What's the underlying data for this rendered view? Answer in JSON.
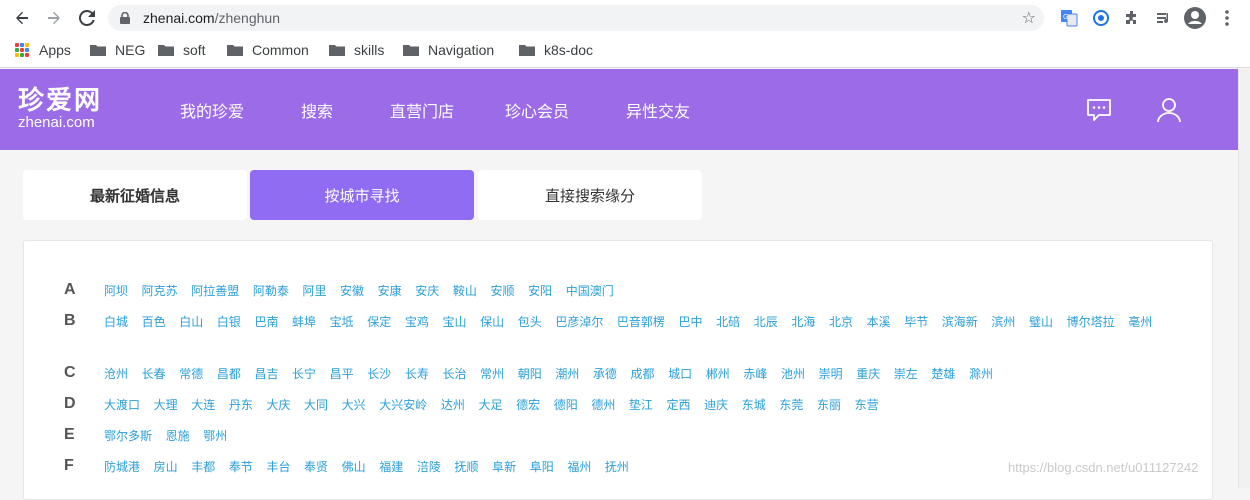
{
  "browser": {
    "url_host": "zhenai.com",
    "url_path": "/zhenghun",
    "bookmarks": [
      "Apps",
      "NEG",
      "soft",
      "Common",
      "skills",
      "Navigation",
      "k8s-doc"
    ]
  },
  "header": {
    "logo_cn": "珍爱网",
    "logo_en": "zhenai.com",
    "nav": [
      "我的珍爱",
      "搜索",
      "直营门店",
      "珍心会员",
      "异性交友"
    ],
    "brand_color": "#9b6be8"
  },
  "tabs": [
    {
      "label": "最新征婚信息"
    },
    {
      "label": "按城市寻找"
    },
    {
      "label": "直接搜索缘分"
    }
  ],
  "city_index": [
    {
      "letter": "A",
      "cities": [
        "阿坝",
        "阿克苏",
        "阿拉善盟",
        "阿勒泰",
        "阿里",
        "安徽",
        "安康",
        "安庆",
        "鞍山",
        "安顺",
        "安阳",
        "中国澳门"
      ]
    },
    {
      "letter": "B",
      "cities": [
        "白城",
        "百色",
        "白山",
        "白银",
        "巴南",
        "蚌埠",
        "宝坻",
        "保定",
        "宝鸡",
        "宝山",
        "保山",
        "包头",
        "巴彦淖尔",
        "巴音郭楞",
        "巴中",
        "北碚",
        "北辰",
        "北海",
        "北京",
        "本溪",
        "毕节",
        "滨海新",
        "滨州",
        "璧山",
        "博尔塔拉",
        "亳州"
      ]
    },
    {
      "letter": "C",
      "cities": [
        "沧州",
        "长春",
        "常德",
        "昌都",
        "昌吉",
        "长宁",
        "昌平",
        "长沙",
        "长寿",
        "长治",
        "常州",
        "朝阳",
        "潮州",
        "承德",
        "成都",
        "城口",
        "郴州",
        "赤峰",
        "池州",
        "崇明",
        "重庆",
        "崇左",
        "楚雄",
        "滁州"
      ]
    },
    {
      "letter": "D",
      "cities": [
        "大渡口",
        "大理",
        "大连",
        "丹东",
        "大庆",
        "大同",
        "大兴",
        "大兴安岭",
        "达州",
        "大足",
        "德宏",
        "德阳",
        "德州",
        "垫江",
        "定西",
        "迪庆",
        "东城",
        "东莞",
        "东丽",
        "东营"
      ]
    },
    {
      "letter": "E",
      "cities": [
        "鄂尔多斯",
        "恩施",
        "鄂州"
      ]
    },
    {
      "letter": "F",
      "cities": [
        "防城港",
        "房山",
        "丰都",
        "奉节",
        "丰台",
        "奉贤",
        "佛山",
        "福建",
        "涪陵",
        "抚顺",
        "阜新",
        "阜阳",
        "福州",
        "抚州"
      ]
    }
  ],
  "watermark": "https://blog.csdn.net/u011127242"
}
